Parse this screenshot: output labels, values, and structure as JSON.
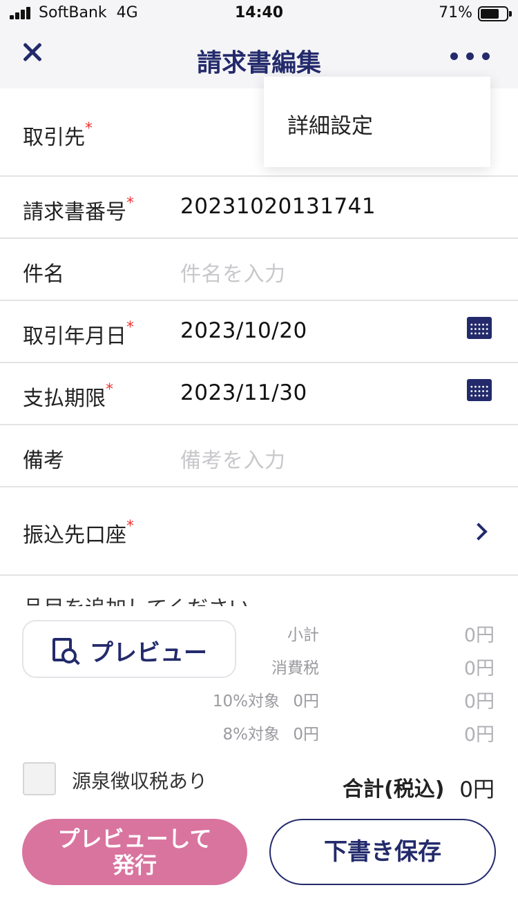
{
  "status_bar": {
    "carrier": "SoftBank",
    "network": "4G",
    "time": "14:40",
    "battery": "71%",
    "battery_level": 0.71
  },
  "nav": {
    "title": "請求書編集",
    "close_icon": "close-icon",
    "more_icon": "more-horizontal-icon"
  },
  "dropdown": {
    "item": "詳細設定"
  },
  "form": {
    "client": {
      "label": "取引先",
      "required": "*"
    },
    "invoice_number": {
      "label": "請求書番号",
      "required": "*",
      "value": "20231020131741"
    },
    "subject": {
      "label": "件名",
      "placeholder": "件名を入力"
    },
    "transaction_date": {
      "label": "取引年月日",
      "required": "*",
      "value": "2023/10/20",
      "icon": "calendar-icon"
    },
    "due_date": {
      "label": "支払期限",
      "required": "*",
      "value": "2023/11/30",
      "icon": "calendar-icon"
    },
    "remarks": {
      "label": "備考",
      "placeholder": "備考を入力"
    },
    "bank_account": {
      "label": "振込先口座",
      "required": "*",
      "icon": "chevron-right-icon"
    }
  },
  "items_hint": "品目を追加してください",
  "summary": {
    "preview_label": "プレビュー",
    "preview_icon": "document-search-icon",
    "subtotal_label": "小計",
    "subtotal_value": "0円",
    "tax_label": "消費税",
    "tax_value": "0円",
    "tax10_label": "10%対象",
    "tax10_base": "0円",
    "tax10_value": "0円",
    "tax8_label": "8%対象",
    "tax8_base": "0円",
    "tax8_value": "0円",
    "withholding_label": "源泉徴収税あり",
    "withholding_checked": false,
    "total_label": "合計(税込)",
    "total_value": "0円"
  },
  "actions": {
    "issue_line1": "プレビューして",
    "issue_line2": "発行",
    "draft_label": "下書き保存"
  },
  "colors": {
    "accent": "#232a6b",
    "issue_button": "#d9749f",
    "required": "#e33333",
    "background_bar": "#f5f5f7"
  }
}
